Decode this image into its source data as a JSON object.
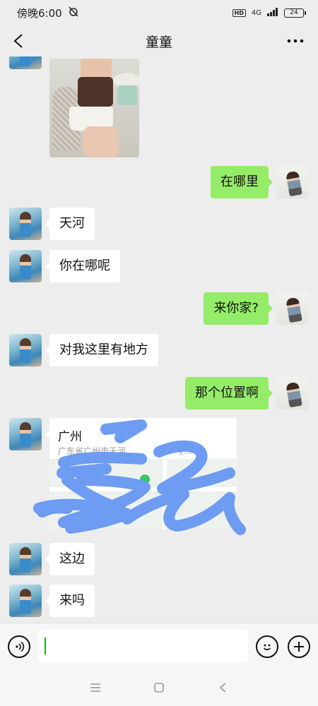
{
  "status_bar": {
    "time": "傍晚6:00",
    "network": "4G",
    "battery": "24",
    "hd_label": "HD"
  },
  "header": {
    "title": "童童",
    "back_icon": "chevron-left-icon",
    "more_icon": "more-dots-icon"
  },
  "messages": [
    {
      "sender": "friend",
      "type": "image"
    },
    {
      "sender": "me",
      "type": "text",
      "text": "在哪里"
    },
    {
      "sender": "friend",
      "type": "text",
      "text": "天河"
    },
    {
      "sender": "friend",
      "type": "text",
      "text": "你在哪呢"
    },
    {
      "sender": "me",
      "type": "text",
      "text": "来你家?"
    },
    {
      "sender": "friend",
      "type": "text",
      "text": "对我这里有地方"
    },
    {
      "sender": "me",
      "type": "text",
      "text": "那个位置啊"
    },
    {
      "sender": "friend",
      "type": "location",
      "title": "广州",
      "address": "广东省广州市天河",
      "address_suffix": "号..."
    },
    {
      "sender": "friend",
      "type": "text",
      "text": "这边"
    },
    {
      "sender": "friend",
      "type": "text",
      "text": "来吗"
    }
  ],
  "input_bar": {
    "value": "",
    "voice_icon": "voice-icon",
    "emoji_icon": "emoji-icon",
    "plus_icon": "plus-circle-icon"
  },
  "colors": {
    "my_bubble": "#95ec69",
    "friend_bubble": "#ffffff",
    "background": "#ededed",
    "scribble": "#6d9cf2"
  }
}
